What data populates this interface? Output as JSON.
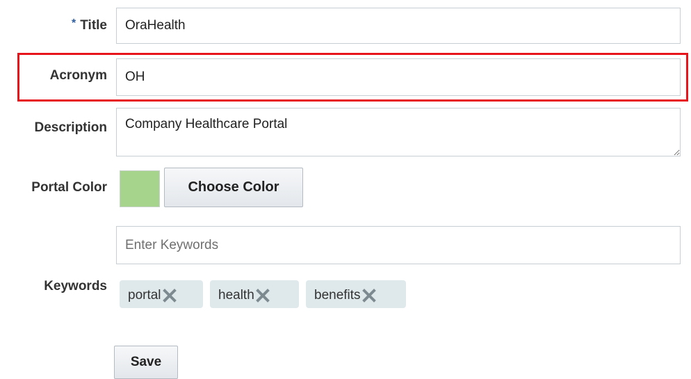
{
  "form": {
    "title": {
      "required_marker": "*",
      "label": "Title",
      "value": "OraHealth"
    },
    "acronym": {
      "label": "Acronym",
      "value": "OH"
    },
    "description": {
      "label": "Description",
      "value": "Company Healthcare Portal"
    },
    "portal_color": {
      "label": "Portal Color",
      "swatch_color": "#a6d48c",
      "choose_button": "Choose Color"
    },
    "keywords": {
      "label": "Keywords",
      "input_placeholder": "Enter Keywords",
      "input_value": "",
      "tags": [
        {
          "label": "portal",
          "remove_icon": "close-x-icon"
        },
        {
          "label": "health",
          "remove_icon": "close-x-icon"
        },
        {
          "label": "benefits",
          "remove_icon": "close-x-icon"
        }
      ]
    },
    "save_button": "Save"
  },
  "colors": {
    "highlight_border": "#e8141c",
    "required_marker": "#2c5d9f",
    "tag_background": "#dfe9ec"
  }
}
